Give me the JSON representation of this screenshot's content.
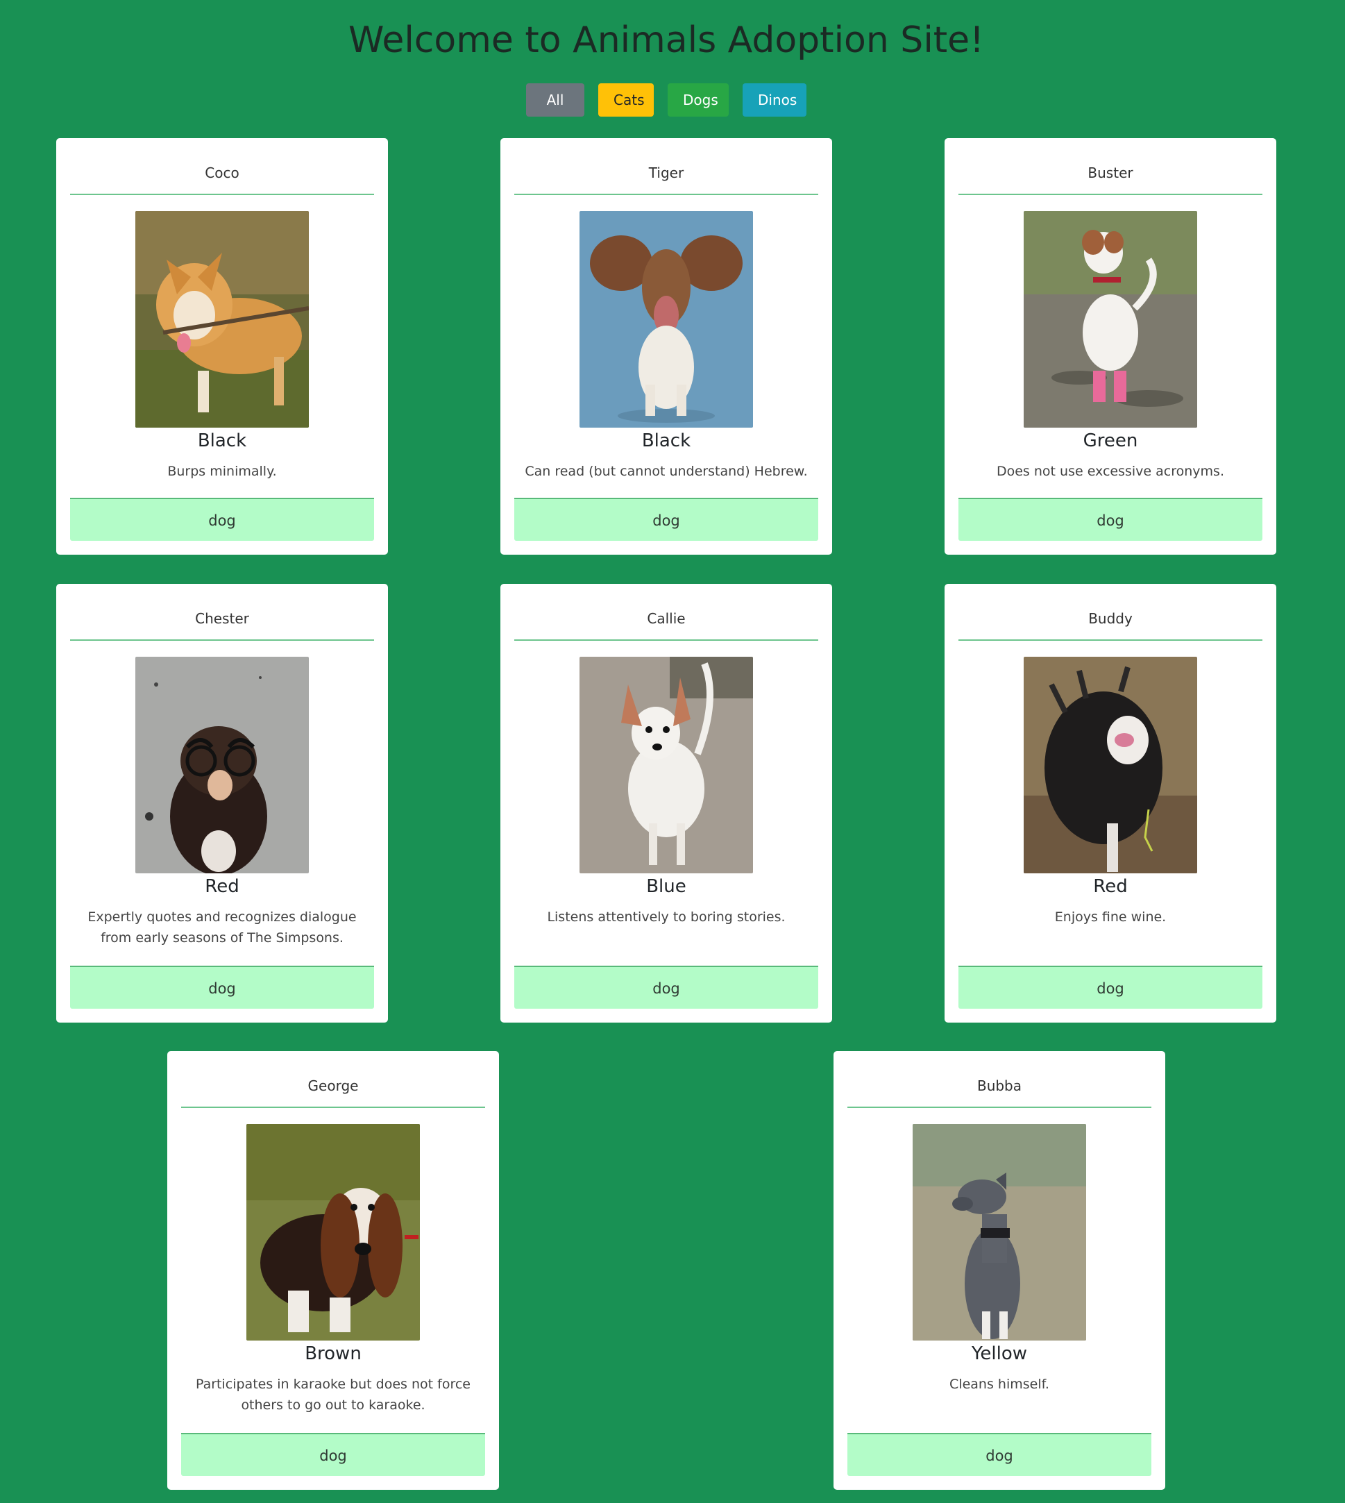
{
  "page": {
    "title": "Welcome to Animals Adoption Site!",
    "filters": [
      "All",
      "Cats",
      "Dogs",
      "Dinos"
    ]
  },
  "animals": [
    {
      "name": "Coco",
      "color": "Black",
      "description": "Burps minimally.",
      "type": "dog"
    },
    {
      "name": "Tiger",
      "color": "Black",
      "description": "Can read (but cannot understand) Hebrew.",
      "type": "dog"
    },
    {
      "name": "Buster",
      "color": "Green",
      "description": "Does not use excessive acronyms.",
      "type": "dog"
    },
    {
      "name": "Chester",
      "color": "Red",
      "description": "Expertly quotes and recognizes dialogue from early seasons of The Simpsons.",
      "type": "dog"
    },
    {
      "name": "Callie",
      "color": "Blue",
      "description": "Listens attentively to boring stories.",
      "type": "dog"
    },
    {
      "name": "Buddy",
      "color": "Red",
      "description": "Enjoys fine wine.",
      "type": "dog"
    },
    {
      "name": "George",
      "color": "Brown",
      "description": "Participates in karaoke but does not force others to go out to karaoke.",
      "type": "dog"
    },
    {
      "name": "Bubba",
      "color": "Yellow",
      "description": "Cleans himself.",
      "type": "dog"
    }
  ]
}
